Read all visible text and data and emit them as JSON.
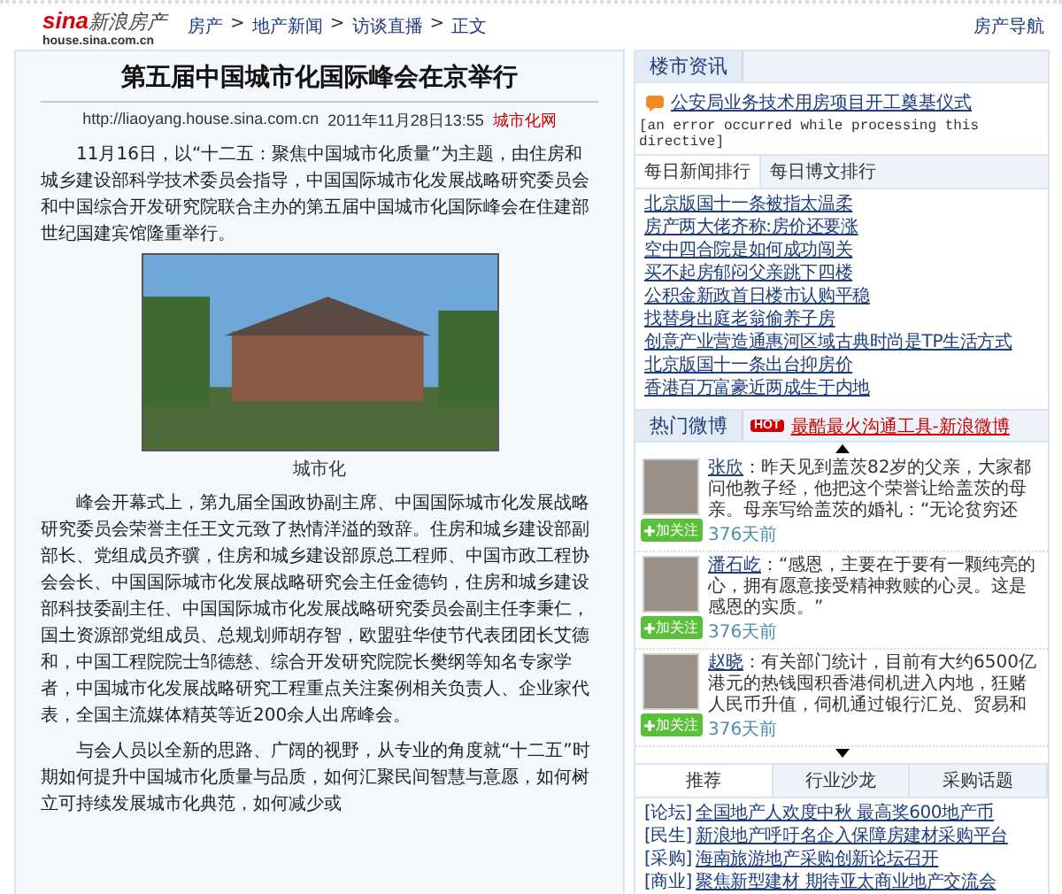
{
  "header": {
    "logo": {
      "brand": "sina",
      "name": "新浪房产",
      "domain": "house.sina.com.cn"
    },
    "breadcrumbs": [
      "房产",
      "地产新闻",
      "访谈直播",
      "正文"
    ],
    "separator": ">",
    "nav_link": "房产导航"
  },
  "article": {
    "title": "第五届中国城市化国际峰会在京举行",
    "source_url": "http://liaoyang.house.sina.com.cn",
    "date": "2011年11月28日13:55",
    "source": "城市化网",
    "intro": "11月16日，以“十二五：聚焦中国城市化质量”为主题，由住房和城乡建设部科学技术委员会指导，中国国际城市化发展战略研究委员会和中国综合开发研究院联合主办的第五届中国城市化国际峰会在住建部世纪国建宾馆隆重举行。",
    "image_caption": "城市化",
    "paragraphs": [
      "峰会开幕式上，第九届全国政协副主席、中国国际城市化发展战略研究委员会荣誉主任王文元致了热情洋溢的致辞。住房和城乡建设部副部长、党组成员齐骥，住房和城乡建设部原总工程师、中国市政工程协会会长、中国国际城市化发展战略研究会主任金德钧，住房和城乡建设部科技委副主任、中国国际城市化发展战略研究委员会副主任李秉仁，国土资源部党组成员、总规划师胡存智，欧盟驻华使节代表团团长艾德和，中国工程院院士邹德慈、综合开发研究院院长樊纲等知名专家学者，中国城市化发展战略研究工程重点关注案例相关负责人、企业家代表，全国主流媒体精英等近200余人出席峰会。",
      "与会人员以全新的思路、广阔的视野，从专业的角度就“十二五”时期如何提升中国城市化质量与品质，如何汇聚民间智慧与意愿，如何树立可持续发展城市化典范，如何减少或"
    ]
  },
  "sidebar": {
    "news": {
      "title": "楼市资讯",
      "headline": "公安局业务技术用房项目开工奠基仪式",
      "error_text": "[an error occurred while processing this directive]"
    },
    "ranking_tabs": [
      {
        "label": "每日新闻排行",
        "selected": true
      },
      {
        "label": "每日博文排行",
        "selected": false
      }
    ],
    "ranking_items": [
      "北京版国十一条被指太温柔",
      "房产两大佬齐称:房价还要涨",
      "空中四合院是如何成功闯关",
      "买不起房郁闷父亲跳下四楼",
      "公积金新政首日楼市认购平稳",
      "找替身出庭老翁偷养子房",
      "创意产业营造通惠河区域古典时尚是TP生活方式",
      "北京版国十一条出台抑房价",
      "香港百万富豪近两成生于内地"
    ],
    "weibo": {
      "title": "热门微博",
      "hot_badge": "HOT",
      "promo": "最酷最火沟通工具-新浪微博",
      "posts": [
        {
          "name": "张欣",
          "text": "：昨天见到盖茨82岁的父亲，大家都问他教子经，他把这个荣誉让给盖茨的母亲。母亲写给盖茨的婚礼：“无论贫穷还",
          "follow": "加关注",
          "time": "376天前"
        },
        {
          "name": "潘石屹",
          "text": "：“感恩，主要在于要有一颗纯亮的心，拥有愿意接受精神救赎的心灵。这是感恩的实质。”",
          "follow": "加关注",
          "time": "376天前"
        },
        {
          "name": "赵晓",
          "text": "：有关部门统计，目前有大约6500亿港元的热钱囤积香港伺机进入内地，狂赌人民币升值，伺机通过银行汇兑、贸易和",
          "follow": "加关注",
          "time": "376天前"
        }
      ]
    },
    "bottom_tabs": [
      {
        "label": "推荐",
        "selected": true
      },
      {
        "label": "行业沙龙",
        "selected": false
      },
      {
        "label": "采购话题",
        "selected": false
      }
    ],
    "bottom_links": [
      {
        "tag": "[论坛]",
        "text": "全国地产人欢度中秋 最高奖600地产币"
      },
      {
        "tag": "[民生]",
        "text": "新浪地产呼吁名企入保障房建材采购平台"
      },
      {
        "tag": "[采购]",
        "text": "海南旅游地产采购创新论坛召开"
      },
      {
        "tag": "[商业]",
        "text": "聚焦新型建材 期待亚太商业地产交流会"
      }
    ]
  }
}
